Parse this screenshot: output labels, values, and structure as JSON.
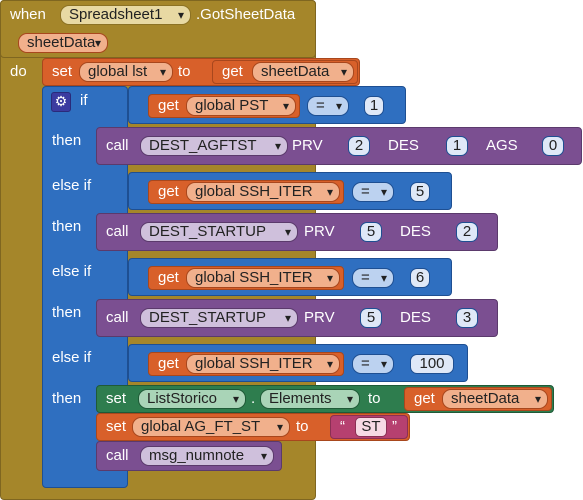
{
  "event": {
    "when": "when",
    "component": "Spreadsheet1",
    "event_name": ".GotSheetData",
    "param": "sheetData",
    "do": "do"
  },
  "set1": {
    "set": "set",
    "var": "global lst",
    "to": "to",
    "get": "get",
    "value": "sheetData"
  },
  "if": {
    "label": "if",
    "get": "get",
    "var": "global PST",
    "op": "=",
    "num": "1"
  },
  "then1": {
    "label": "then",
    "call": "call",
    "proc": "DEST_AGFTST",
    "a1": "PRV",
    "v1": "2",
    "a2": "DES",
    "v2": "1",
    "a3": "AGS",
    "v3": "0"
  },
  "elseif1": {
    "label": "else if",
    "get": "get",
    "var": "global SSH_ITER",
    "op": "=",
    "num": "5"
  },
  "then2": {
    "label": "then",
    "call": "call",
    "proc": "DEST_STARTUP",
    "a1": "PRV",
    "v1": "5",
    "a2": "DES",
    "v2": "2"
  },
  "elseif2": {
    "label": "else if",
    "get": "get",
    "var": "global SSH_ITER",
    "op": "=",
    "num": "6"
  },
  "then3": {
    "label": "then",
    "call": "call",
    "proc": "DEST_STARTUP",
    "a1": "PRV",
    "v1": "5",
    "a2": "DES",
    "v2": "3"
  },
  "elseif3": {
    "label": "else if",
    "get": "get",
    "var": "global SSH_ITER",
    "op": "=",
    "num": "100"
  },
  "then4": {
    "label": "then",
    "set_set": "set",
    "component": "ListStorico",
    "dot": ".",
    "prop": "Elements",
    "to": "to",
    "get": "get",
    "value": "sheetData",
    "set2_set": "set",
    "set2_var": "global AG_FT_ST",
    "set2_to": "to",
    "q_open": "“",
    "str": "ST",
    "q_close": "”",
    "call": "call",
    "proc": "msg_numnote"
  },
  "icons": {
    "mutator": "gear-icon"
  },
  "colors": {
    "event": "#a5862a",
    "control": "#2f6fc0",
    "procedure": "#7b4f91",
    "variable": "#d8602a",
    "component": "#2e7d4e",
    "text": "#b64070"
  }
}
